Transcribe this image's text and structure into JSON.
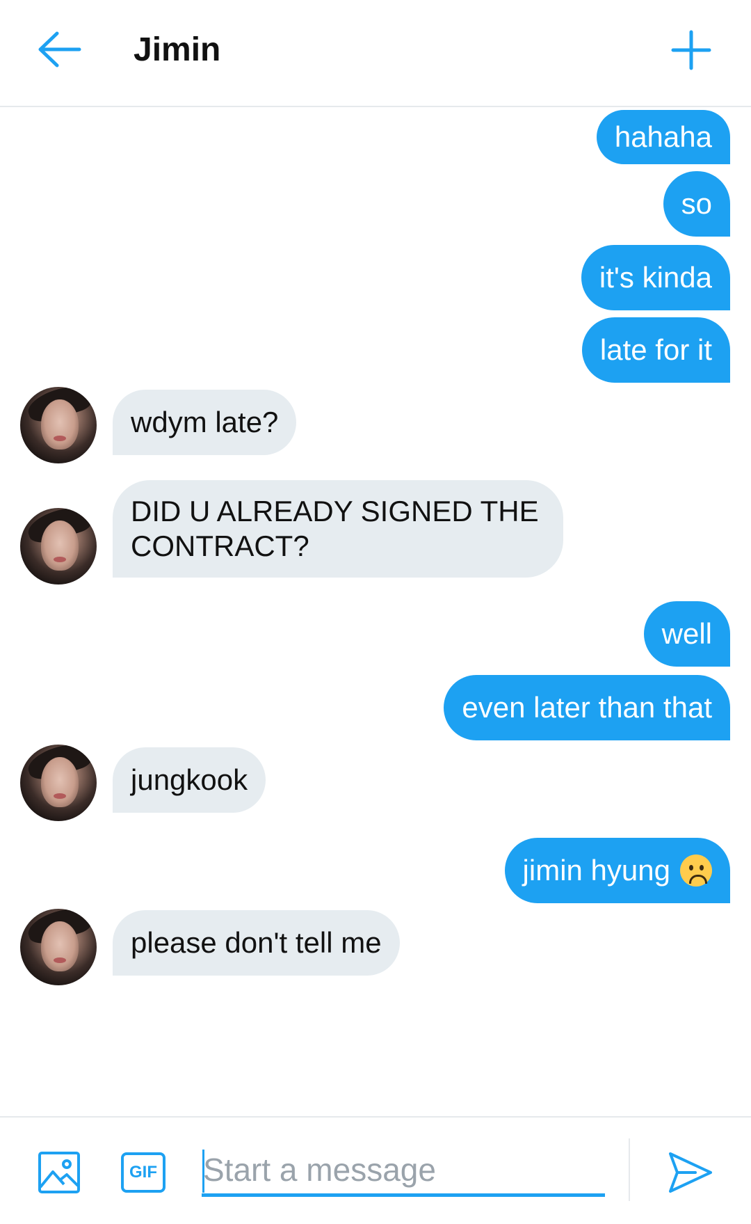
{
  "header": {
    "title": "Jimin",
    "back_icon": "arrow-left-icon",
    "add_icon": "plus-icon"
  },
  "messages": [
    {
      "side": "out",
      "text": "hahaha"
    },
    {
      "side": "out",
      "text": "so"
    },
    {
      "side": "out",
      "text": "it's kinda"
    },
    {
      "side": "out",
      "text": "late for it"
    },
    {
      "side": "in",
      "text": "wdym late?"
    },
    {
      "side": "in",
      "text": "DID U ALREADY SIGNED THE CONTRACT?"
    },
    {
      "side": "out",
      "text": "well"
    },
    {
      "side": "out",
      "text": "even later than that"
    },
    {
      "side": "in",
      "text": "jungkook"
    },
    {
      "side": "out",
      "text": "jimin hyung",
      "emoji": "frowning-face"
    },
    {
      "side": "in",
      "text": "please don't tell me"
    }
  ],
  "composer": {
    "placeholder": "Start a message",
    "gif_label": "GIF",
    "media_icon": "image-icon",
    "send_icon": "send-icon"
  },
  "colors": {
    "accent": "#1da1f2",
    "incoming_bubble": "#e6ecf0",
    "outgoing_text": "#ffffff"
  }
}
